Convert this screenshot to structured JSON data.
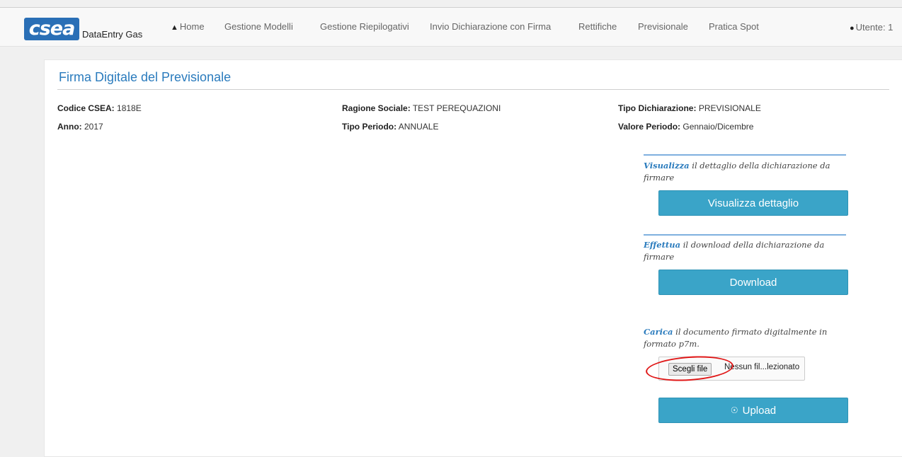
{
  "navbar": {
    "logo_text": "csea",
    "brand": "DataEntry Gas",
    "items": [
      {
        "label": "Home"
      },
      {
        "label": "Gestione Modelli"
      },
      {
        "label": "Gestione Riepilogativi"
      },
      {
        "label": "Invio Dichiarazione con Firma"
      },
      {
        "label": "Rettifiche"
      },
      {
        "label": "Previsionale"
      },
      {
        "label": "Pratica Spot"
      }
    ],
    "user_label": "Utente: 1"
  },
  "page": {
    "title": "Firma Digitale del Previsionale",
    "fields": [
      {
        "label": "Codice CSEA:",
        "value": "1818E"
      },
      {
        "label": "Ragione Sociale:",
        "value": "TEST PEREQUAZIONI"
      },
      {
        "label": "Tipo Dichiarazione:",
        "value": "PREVISIONALE"
      },
      {
        "label": "Anno:",
        "value": "2017"
      },
      {
        "label": "Tipo Periodo:",
        "value": "ANNUALE"
      },
      {
        "label": "Valore Periodo:",
        "value": "Gennaio/Dicembre"
      }
    ]
  },
  "actions": {
    "view": {
      "keyword": "Visualizza",
      "text": "il dettaglio della dichiarazione da firmare",
      "button": "Visualizza dettaglio"
    },
    "download": {
      "keyword": "Effettua",
      "text": "il download della dichiarazione da firmare",
      "button": "Download"
    },
    "upload": {
      "keyword": "Carica",
      "text": "il documento firmato digitalmente in formato p7m.",
      "choose_button": "Scegli file",
      "no_file": "Nessun fil...lezionato",
      "button": "Upload"
    }
  },
  "colors": {
    "accent": "#2a7bbd",
    "button": "#3aa4c8",
    "highlight": "#e01818",
    "logo": "#2a6fb6"
  }
}
